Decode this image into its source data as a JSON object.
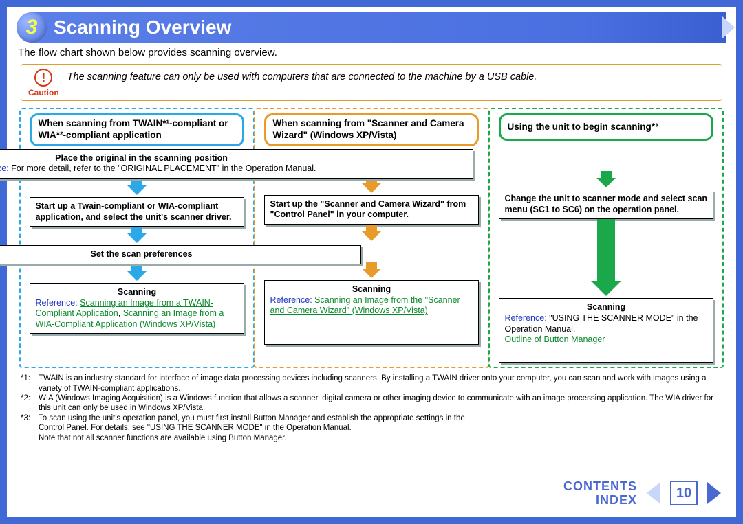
{
  "chapter": {
    "number": "3",
    "title": "Scanning Overview"
  },
  "intro": "The flow chart shown below provides scanning overview.",
  "caution": {
    "label": "Caution",
    "text": "The scanning feature can only be used with computers that are connected to the machine by a USB cable."
  },
  "columns": {
    "c1_header": "When scanning from TWAIN*¹-compliant or WIA*²-compliant application",
    "c2_header": "When scanning from \"Scanner and Camera Wizard\" (Windows XP/Vista)",
    "c3_header": "Using the unit to begin scanning*³"
  },
  "steps": {
    "place_title": "Place the original in the scanning position",
    "place_ref_label": "Reference:",
    "place_ref_text": " For more detail, refer to the \"ORIGINAL PLACEMENT\" in the Operation Manual.",
    "c1_start": "Start up a Twain-compliant or WIA-compliant application, and select the unit's scanner driver.",
    "c2_start": "Start up the \"Scanner and Camera Wizard\" from \"Control Panel\" in your computer.",
    "c3_start": "Change the unit to scanner mode and select scan menu (SC1 to SC6) on the operation panel.",
    "set_prefs": "Set the scan preferences",
    "scanning_title": "Scanning",
    "ref_label": "Reference:",
    "c1_ref_link1": "Scanning an Image from a TWAIN-Compliant Application",
    "c1_ref_link2": "Scanning an Image from a WIA-Compliant Application (Windows XP/Vista)",
    "c2_ref_link": "Scanning an Image from the \"Scanner and Camera Wizard\" (Windows XP/Vista)",
    "c3_ref_text": " \"USING THE SCANNER MODE\" in the Operation Manual,",
    "c3_ref_link": "Outline of Button Manager"
  },
  "footnotes": {
    "f1_key": "*1:",
    "f1": "TWAIN is an industry standard for interface of image data processing devices including scanners. By installing a TWAIN driver onto your computer, you can scan and work with images using a variety of TWAIN-compliant applications.",
    "f2_key": "*2:",
    "f2": "WIA (Windows Imaging Acquisition) is a Windows function that allows a scanner, digital camera or other imaging device to communicate with an image processing application. The WIA driver for this unit can only be used in Windows XP/Vista.",
    "f3_key": "*3:",
    "f3": "To scan using the unit's operation panel, you must first install Button Manager and establish the appropriate settings in the Control Panel. For details, see \"USING THE SCANNER MODE\" in the Operation Manual.",
    "note": "Note that not all scanner functions are available using Button Manager."
  },
  "nav": {
    "contents": "CONTENTS",
    "index": "INDEX",
    "page": "10"
  }
}
